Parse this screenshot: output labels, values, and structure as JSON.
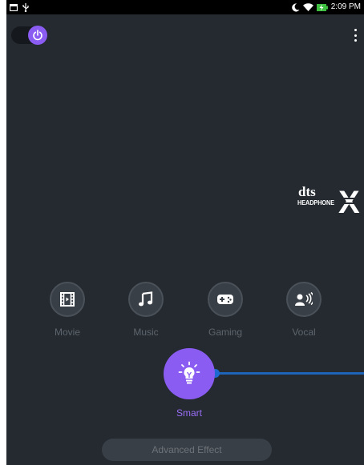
{
  "status_bar": {
    "time": "2:09 PM",
    "icons": [
      "notification-icon",
      "usb-icon",
      "moon-icon",
      "wifi-icon",
      "battery-charging-icon"
    ]
  },
  "header": {
    "power_state": "on",
    "menu_icon": "more-vert-icon"
  },
  "logo": {
    "brand": "dts",
    "product": "HEADPHONE",
    "mark": "X"
  },
  "modes": [
    {
      "label": "Movie",
      "icon": "film-icon"
    },
    {
      "label": "Music",
      "icon": "music-note-icon"
    },
    {
      "label": "Gaming",
      "icon": "gamepad-icon"
    },
    {
      "label": "Vocal",
      "icon": "speaker-voice-icon"
    }
  ],
  "smart": {
    "label": "Smart",
    "icon": "lightbulb-icon"
  },
  "advanced_button": {
    "label": "Advanced Effect"
  },
  "colors": {
    "accent": "#8a5cf2",
    "background": "#242a30",
    "slider": "#1e64b8",
    "inactive_text": "#5f656c"
  }
}
